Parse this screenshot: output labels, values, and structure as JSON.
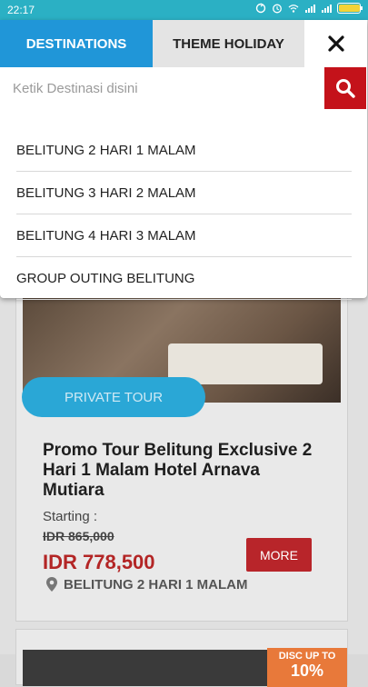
{
  "status_bar": {
    "time": "22:17",
    "icons": [
      "rotate-icon",
      "alarm-icon",
      "wifi-icon",
      "signal-icon",
      "signal-icon",
      "battery-icon"
    ],
    "battery_level": 0.95
  },
  "modal": {
    "tabs": [
      {
        "label": "DESTINATIONS",
        "active": true
      },
      {
        "label": "THEME HOLIDAY",
        "active": false
      }
    ],
    "close_label": "✕",
    "search": {
      "placeholder": "Ketik Destinasi disini",
      "value": ""
    },
    "suggestions": [
      "BELITUNG 2 HARI 1 MALAM",
      "BELITUNG 3 HARI 2 MALAM",
      "BELITUNG 4 HARI 3 MALAM",
      "GROUP OUTING BELITUNG"
    ]
  },
  "card": {
    "badge": "PRIVATE TOUR",
    "title": "Promo Tour Belitung Exclusive 2 Hari 1 Malam Hotel Arnava Mutiara",
    "starting_label": "Starting :",
    "old_price": "IDR 865,000",
    "new_price": "IDR 778,500",
    "more_label": "MORE",
    "location": "BELITUNG 2 HARI 1 MALAM"
  },
  "card2": {
    "disc_line1": "DISC UP TO",
    "disc_line2": "10%"
  },
  "colors": {
    "accent_blue": "#2096d8",
    "search_red": "#c4121a",
    "price_red": "#b32525"
  }
}
